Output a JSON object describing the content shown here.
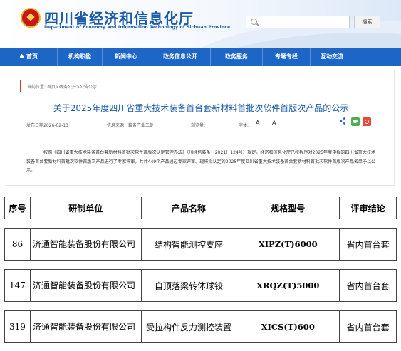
{
  "site": {
    "title": "四川省经济和信息化厅",
    "subtitle": "Department of Economy and Information Technology of Sichuan Province",
    "search_button": "搜索",
    "search_placeholder": ""
  },
  "nav": [
    {
      "label": "首页",
      "icon": "home-icon"
    },
    {
      "label": "机构职能"
    },
    {
      "label": "新闻中心"
    },
    {
      "label": "政务信息公开"
    },
    {
      "label": "政务服务"
    },
    {
      "label": "专题专栏"
    },
    {
      "label": "互动交流"
    }
  ],
  "article": {
    "breadcrumb": "当前位置: 首页>政务公开>公告公示",
    "title": "关于2025年度四川省重大技术装备首台套新材料首批次软件首版次产品的公示",
    "publish_date": "发布日期2026-02-13",
    "source": "信息来源：装备产业二处",
    "views": "浏览量:",
    "font_label": "字体:",
    "font_increase": "A⁺",
    "font_decrease": "A⁻",
    "body": "按照《四川省重大技术装备首台套新材料首批次软件首版次认定管理办法》（川经信装备〔2021〕124号）规定，经济和信息化厅已按程序对2025年度申报的四川省重大技术装备首台套新材料首批次软件首版次产品进行了专家评审，共计449个产品通过专家评审。现将拟认定的2025年度四川省重大技术装备首台套新材料首批次软件首版次产品名单予以公示。"
  },
  "table": {
    "headers": [
      "序号",
      "研制单位",
      "产品名称",
      "规格型号",
      "评审结论"
    ],
    "rows": [
      {
        "no": "86",
        "unit": "济通智能装备股份有限公司",
        "product": "结构智能测控支座",
        "model": "XIPZ(T)6000",
        "result": "省内首台套"
      },
      {
        "no": "147",
        "unit": "济通智能装备股份有限公司",
        "product": "自顶落梁转体球铰",
        "model": "XRQZ(T)5000",
        "result": "省内首台套"
      },
      {
        "no": "319",
        "unit": "济通智能装备股份有限公司",
        "product": "受拉构件反力测控装置",
        "model": "XICS(T)600",
        "result": "省内首台套"
      }
    ]
  },
  "colors": {
    "brand_blue": "#1e66c5",
    "title_blue": "#1a5aa8"
  }
}
